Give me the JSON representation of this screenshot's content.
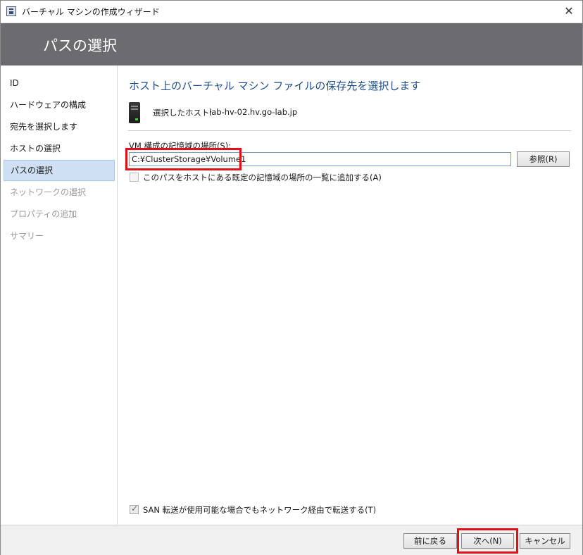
{
  "window": {
    "title": "バーチャル マシンの作成ウィザード",
    "close_glyph": "✕"
  },
  "header": {
    "title": "パスの選択"
  },
  "sidebar": {
    "items": [
      {
        "label": "ID",
        "state": "enabled"
      },
      {
        "label": "ハードウェアの構成",
        "state": "enabled"
      },
      {
        "label": "宛先を選択します",
        "state": "enabled"
      },
      {
        "label": "ホストの選択",
        "state": "enabled"
      },
      {
        "label": "パスの選択",
        "state": "active"
      },
      {
        "label": "ネットワークの選択",
        "state": "disabled"
      },
      {
        "label": "プロパティの追加",
        "state": "disabled"
      },
      {
        "label": "サマリー",
        "state": "disabled"
      }
    ]
  },
  "main": {
    "heading": "ホスト上のバーチャル マシン ファイルの保存先を選択します",
    "selected_host_label": "選択したホスト:",
    "selected_host_value": "lab-hv-02.hv.go-lab.jp",
    "storage_label": "VM 構成の記憶域の場所(S):",
    "storage_path": "C:¥ClusterStorage¥Volume1",
    "browse_label": "参照(R)",
    "add_default_checkbox": {
      "label": "このパスをホストにある既定の記憶域の場所の一覧に追加する(A)",
      "checked": false
    },
    "san_checkbox": {
      "label": "SAN 転送が使用可能な場合でもネットワーク経由で転送する(T)",
      "checked": true
    }
  },
  "footer": {
    "back_label": "前に戻る",
    "next_label": "次へ(N)",
    "cancel_label": "キャンセル"
  },
  "colors": {
    "header_band": "#6b6b70",
    "heading_text": "#1f4e8c",
    "active_nav": "#cfe0f4",
    "highlight_border": "#e0101a"
  }
}
